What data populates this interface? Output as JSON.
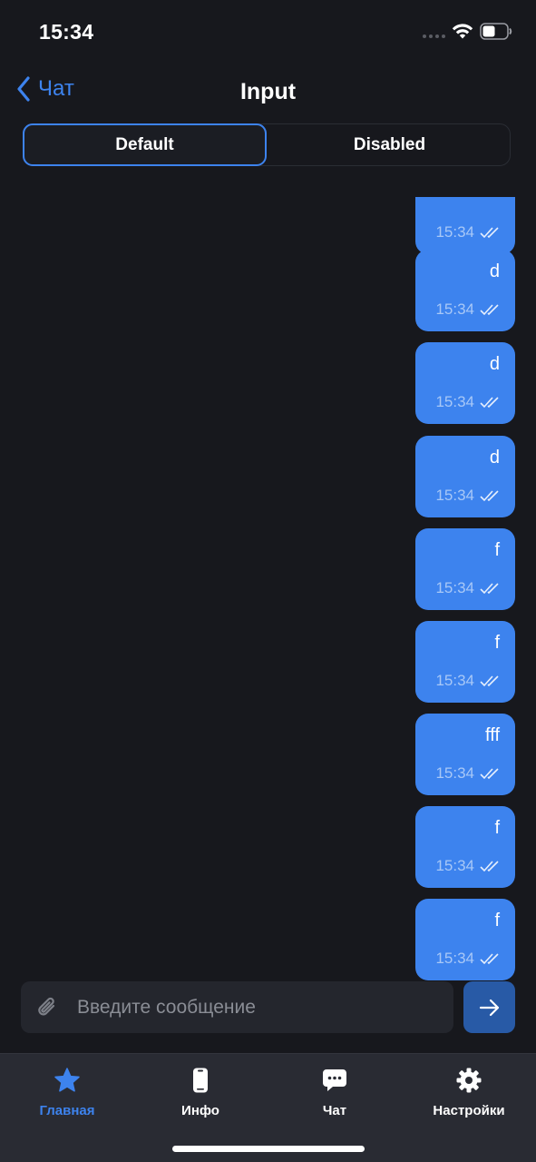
{
  "status_bar": {
    "time": "15:34"
  },
  "nav": {
    "back_label": "Чат",
    "title": "Input"
  },
  "segmented": {
    "default_label": "Default",
    "disabled_label": "Disabled"
  },
  "messages": [
    {
      "text": "",
      "time": "15:34"
    },
    {
      "text": "d",
      "time": "15:34"
    },
    {
      "text": "d",
      "time": "15:34"
    },
    {
      "text": "d",
      "time": "15:34"
    },
    {
      "text": "f",
      "time": "15:34"
    },
    {
      "text": "f",
      "time": "15:34"
    },
    {
      "text": "fff",
      "time": "15:34"
    },
    {
      "text": "f",
      "time": "15:34"
    },
    {
      "text": "f",
      "time": "15:34"
    }
  ],
  "input": {
    "placeholder": "Введите сообщение"
  },
  "tabs": [
    {
      "label": "Главная",
      "icon": "star-icon",
      "active": true
    },
    {
      "label": "Инфо",
      "icon": "phone-icon",
      "active": false
    },
    {
      "label": "Чат",
      "icon": "chat-bubble-icon",
      "active": false
    },
    {
      "label": "Настройки",
      "icon": "gear-icon",
      "active": false
    }
  ],
  "colors": {
    "accent": "#3d83ee",
    "background": "#17181d",
    "bubble": "#3d83ee",
    "tab_bar": "#292b33"
  }
}
